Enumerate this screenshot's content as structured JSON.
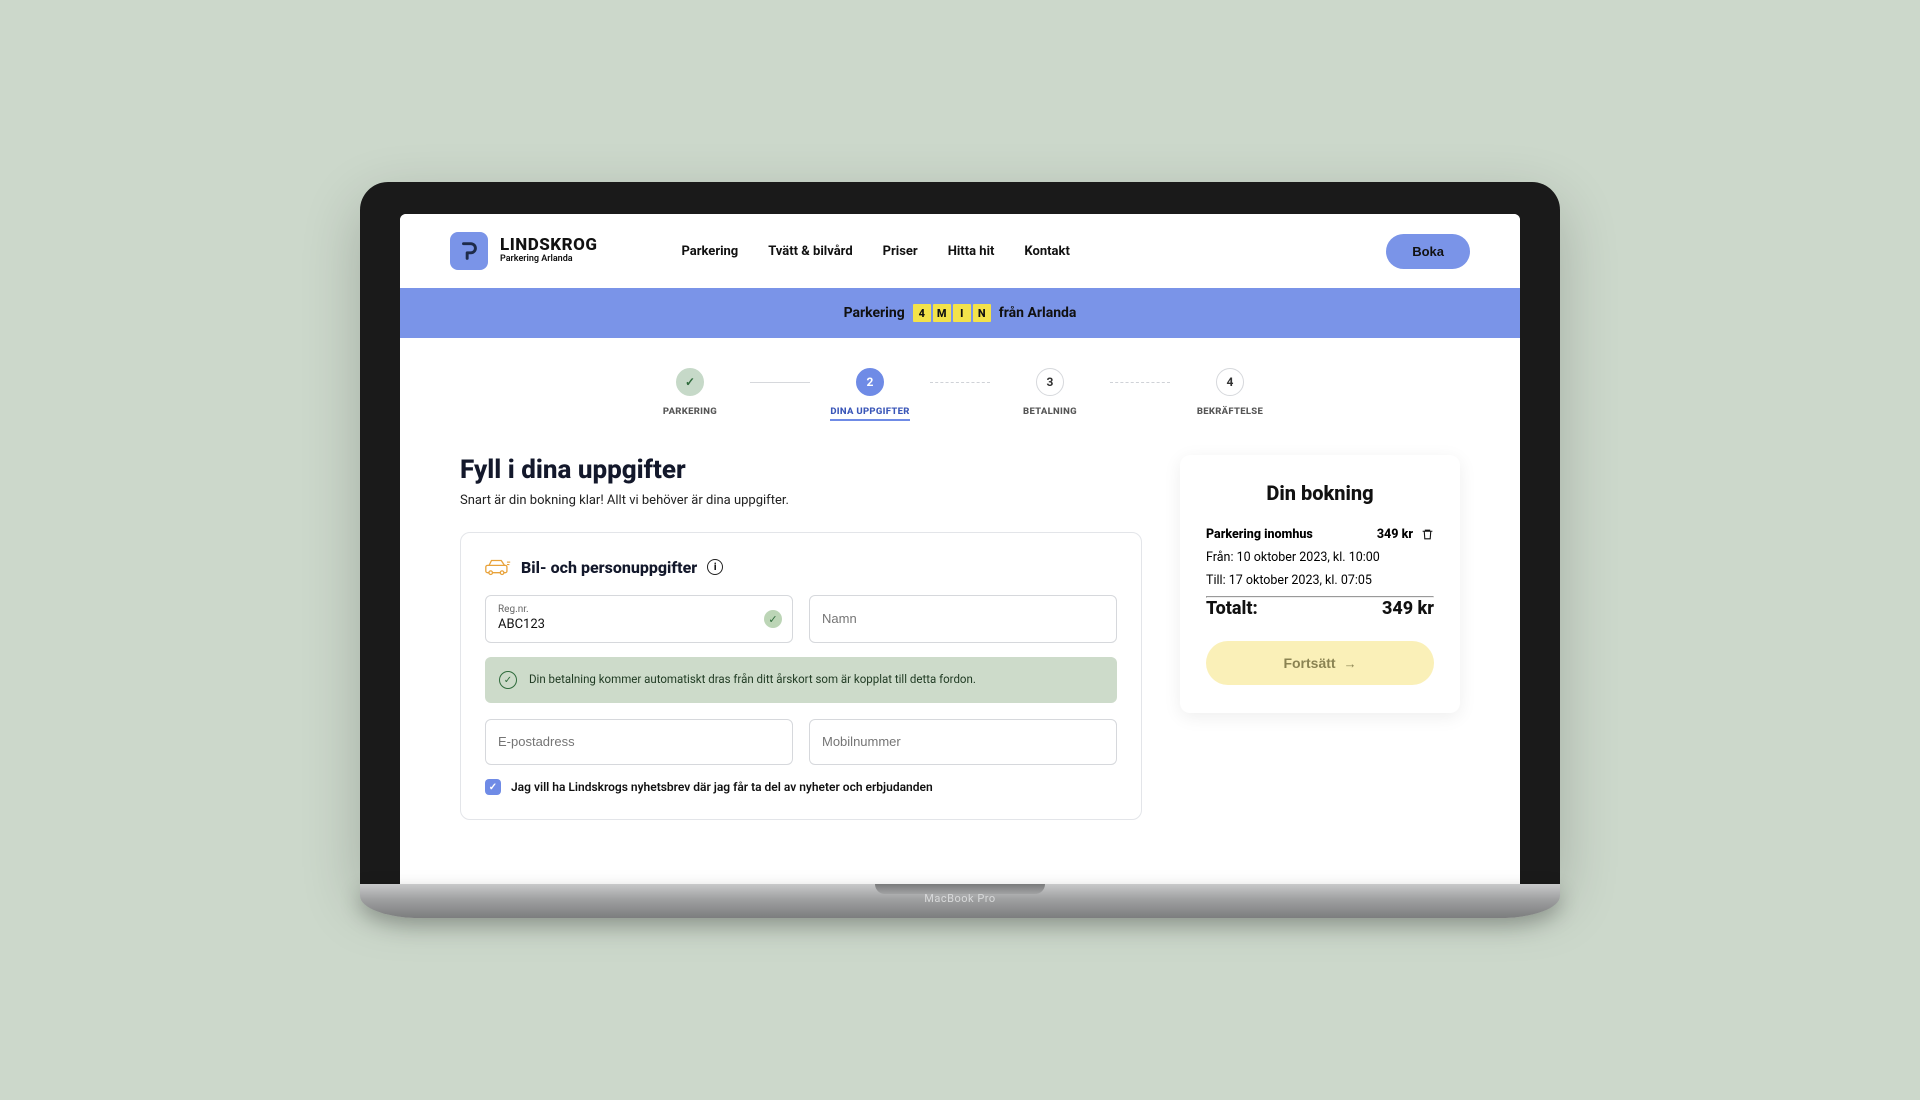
{
  "brand": {
    "name": "LINDSKROG",
    "subtitle": "Parkering Arlanda"
  },
  "nav": {
    "items": [
      "Parkering",
      "Tvätt & bilvård",
      "Priser",
      "Hitta hit",
      "Kontakt"
    ],
    "book": "Boka"
  },
  "banner": {
    "pre": "Parkering",
    "chips": [
      "4",
      "M",
      "I",
      "N"
    ],
    "post": "från Arlanda"
  },
  "steps": [
    {
      "label": "PARKERING",
      "state": "done",
      "num": "✓"
    },
    {
      "label": "DINA UPPGIFTER",
      "state": "active",
      "num": "2"
    },
    {
      "label": "BETALNING",
      "state": "",
      "num": "3"
    },
    {
      "label": "BEKRÄFTELSE",
      "state": "",
      "num": "4"
    }
  ],
  "page": {
    "title": "Fyll i dina uppgifter",
    "subtitle": "Snart är din bokning klar! Allt vi behöver är dina uppgifter."
  },
  "form": {
    "section_title": "Bil- och personuppgifter",
    "reg_label": "Reg.nr.",
    "reg_value": "ABC123",
    "name_placeholder": "Namn",
    "notice": "Din betalning kommer automatiskt dras från ditt årskort som är kopplat till detta fordon.",
    "email_placeholder": "E-postadress",
    "phone_placeholder": "Mobilnummer",
    "newsletter": "Jag vill ha Lindskrogs nyhetsbrev där jag får ta del av nyheter och erbjudanden"
  },
  "summary": {
    "title": "Din bokning",
    "item_label": "Parkering inomhus",
    "item_price": "349 kr",
    "from": "Från: 10 oktober 2023, kl. 10:00",
    "to": "Till: 17 oktober 2023, kl. 07:05",
    "total_label": "Totalt:",
    "total_value": "349 kr",
    "continue": "Fortsätt"
  },
  "device": {
    "label": "MacBook Pro"
  }
}
